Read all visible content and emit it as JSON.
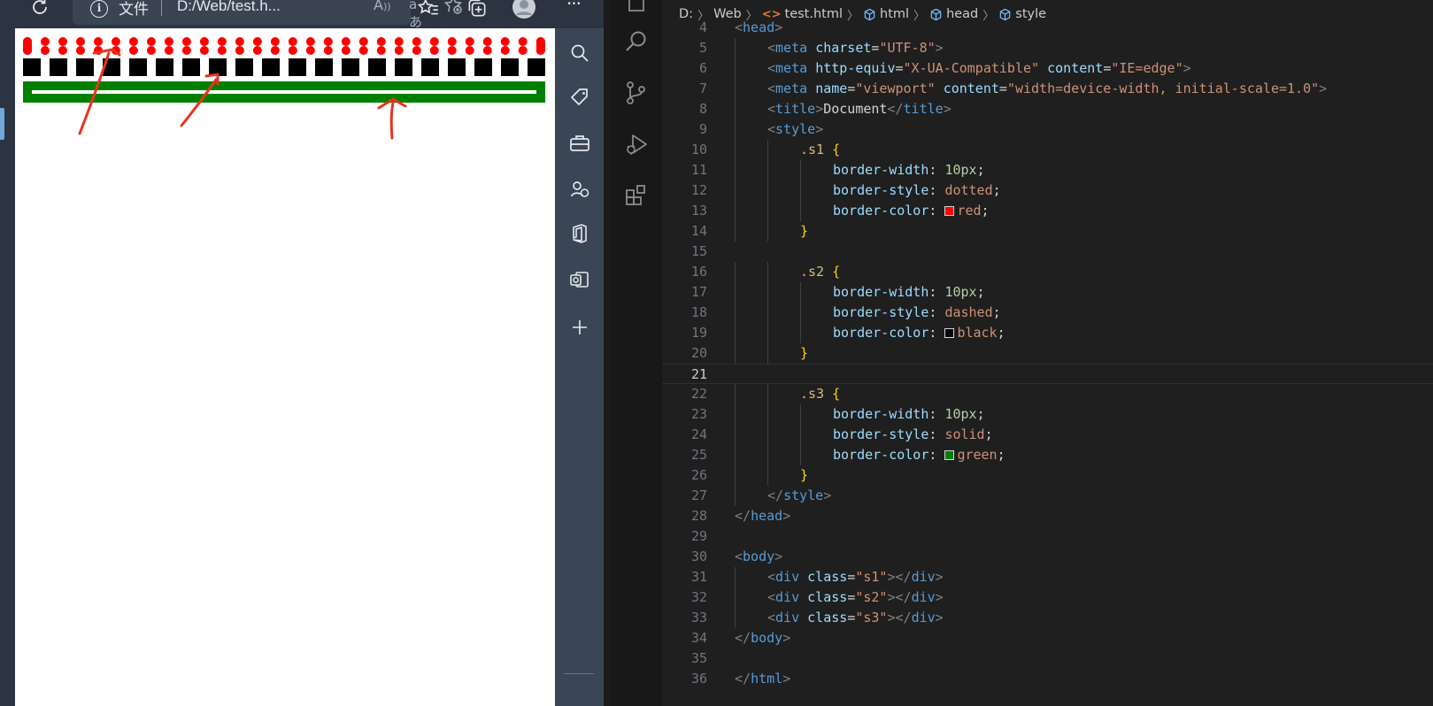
{
  "browser": {
    "address_label": "文件",
    "url": "D:/Web/test.h...",
    "translate_glyph": "aあ",
    "read_glyph": "A⁾"
  },
  "page": {
    "demo_colors": {
      "s1": "#ff0000",
      "s2": "#000000",
      "s3": "#008000"
    },
    "annotation_color": "#e8341c"
  },
  "editor": {
    "breadcrumbs": [
      "D:",
      "Web",
      "test.html",
      "html",
      "head",
      "style"
    ],
    "active_line": 21,
    "lines": [
      {
        "n": 4,
        "indent": 0,
        "tokens": [
          [
            "p",
            "<"
          ],
          [
            "t",
            "head"
          ],
          [
            "p",
            ">"
          ]
        ]
      },
      {
        "n": 5,
        "indent": 1,
        "tokens": [
          [
            "p",
            "<"
          ],
          [
            "t",
            "meta"
          ],
          [
            "x",
            " "
          ],
          [
            "a",
            "charset"
          ],
          [
            "x",
            "="
          ],
          [
            "s",
            "\"UTF-8\""
          ],
          [
            "p",
            ">"
          ]
        ]
      },
      {
        "n": 6,
        "indent": 1,
        "tokens": [
          [
            "p",
            "<"
          ],
          [
            "t",
            "meta"
          ],
          [
            "x",
            " "
          ],
          [
            "a",
            "http-equiv"
          ],
          [
            "x",
            "="
          ],
          [
            "s",
            "\"X-UA-Compatible\""
          ],
          [
            "x",
            " "
          ],
          [
            "a",
            "content"
          ],
          [
            "x",
            "="
          ],
          [
            "s",
            "\"IE=edge\""
          ],
          [
            "p",
            ">"
          ]
        ]
      },
      {
        "n": 7,
        "indent": 1,
        "tokens": [
          [
            "p",
            "<"
          ],
          [
            "t",
            "meta"
          ],
          [
            "x",
            " "
          ],
          [
            "a",
            "name"
          ],
          [
            "x",
            "="
          ],
          [
            "s",
            "\"viewport\""
          ],
          [
            "x",
            " "
          ],
          [
            "a",
            "content"
          ],
          [
            "x",
            "="
          ],
          [
            "s",
            "\"width=device-width, initial-scale=1.0\""
          ],
          [
            "p",
            ">"
          ]
        ]
      },
      {
        "n": 8,
        "indent": 1,
        "tokens": [
          [
            "p",
            "<"
          ],
          [
            "t",
            "title"
          ],
          [
            "p",
            ">"
          ],
          [
            "x",
            "Document"
          ],
          [
            "p",
            "</"
          ],
          [
            "t",
            "title"
          ],
          [
            "p",
            ">"
          ]
        ]
      },
      {
        "n": 9,
        "indent": 1,
        "tokens": [
          [
            "p",
            "<"
          ],
          [
            "t",
            "style"
          ],
          [
            "p",
            ">"
          ]
        ]
      },
      {
        "n": 10,
        "indent": 2,
        "tokens": [
          [
            "sel",
            ".s1"
          ],
          [
            "x",
            " "
          ],
          [
            "b",
            "{"
          ]
        ]
      },
      {
        "n": 11,
        "indent": 3,
        "tokens": [
          [
            "pr",
            "border-width"
          ],
          [
            "x",
            ": "
          ],
          [
            "num",
            "10px"
          ],
          [
            "x",
            ";"
          ]
        ]
      },
      {
        "n": 12,
        "indent": 3,
        "tokens": [
          [
            "pr",
            "border-style"
          ],
          [
            "x",
            ": "
          ],
          [
            "v",
            "dotted"
          ],
          [
            "x",
            ";"
          ]
        ]
      },
      {
        "n": 13,
        "indent": 3,
        "tokens": [
          [
            "pr",
            "border-color"
          ],
          [
            "x",
            ": "
          ],
          [
            "sw",
            "#ff0000"
          ],
          [
            "v",
            "red"
          ],
          [
            "x",
            ";"
          ]
        ]
      },
      {
        "n": 14,
        "indent": 2,
        "tokens": [
          [
            "b",
            "}"
          ]
        ]
      },
      {
        "n": 15,
        "indent": 0,
        "tokens": []
      },
      {
        "n": 16,
        "indent": 2,
        "tokens": [
          [
            "sel",
            ".s2"
          ],
          [
            "x",
            " "
          ],
          [
            "b",
            "{"
          ]
        ]
      },
      {
        "n": 17,
        "indent": 3,
        "tokens": [
          [
            "pr",
            "border-width"
          ],
          [
            "x",
            ": "
          ],
          [
            "num",
            "10px"
          ],
          [
            "x",
            ";"
          ]
        ]
      },
      {
        "n": 18,
        "indent": 3,
        "tokens": [
          [
            "pr",
            "border-style"
          ],
          [
            "x",
            ": "
          ],
          [
            "v",
            "dashed"
          ],
          [
            "x",
            ";"
          ]
        ]
      },
      {
        "n": 19,
        "indent": 3,
        "tokens": [
          [
            "pr",
            "border-color"
          ],
          [
            "x",
            ": "
          ],
          [
            "sw",
            "#000000"
          ],
          [
            "v",
            "black"
          ],
          [
            "x",
            ";"
          ]
        ]
      },
      {
        "n": 20,
        "indent": 2,
        "tokens": [
          [
            "b",
            "}"
          ]
        ]
      },
      {
        "n": 21,
        "indent": 0,
        "tokens": []
      },
      {
        "n": 22,
        "indent": 2,
        "tokens": [
          [
            "sel",
            ".s3"
          ],
          [
            "x",
            " "
          ],
          [
            "b",
            "{"
          ]
        ]
      },
      {
        "n": 23,
        "indent": 3,
        "tokens": [
          [
            "pr",
            "border-width"
          ],
          [
            "x",
            ": "
          ],
          [
            "num",
            "10px"
          ],
          [
            "x",
            ";"
          ]
        ]
      },
      {
        "n": 24,
        "indent": 3,
        "tokens": [
          [
            "pr",
            "border-style"
          ],
          [
            "x",
            ": "
          ],
          [
            "v",
            "solid"
          ],
          [
            "x",
            ";"
          ]
        ]
      },
      {
        "n": 25,
        "indent": 3,
        "tokens": [
          [
            "pr",
            "border-color"
          ],
          [
            "x",
            ": "
          ],
          [
            "sw",
            "#008000"
          ],
          [
            "v",
            "green"
          ],
          [
            "x",
            ";"
          ]
        ]
      },
      {
        "n": 26,
        "indent": 2,
        "tokens": [
          [
            "b",
            "}"
          ]
        ]
      },
      {
        "n": 27,
        "indent": 1,
        "tokens": [
          [
            "p",
            "</"
          ],
          [
            "t",
            "style"
          ],
          [
            "p",
            ">"
          ]
        ]
      },
      {
        "n": 28,
        "indent": 0,
        "tokens": [
          [
            "p",
            "</"
          ],
          [
            "t",
            "head"
          ],
          [
            "p",
            ">"
          ]
        ]
      },
      {
        "n": 29,
        "indent": 0,
        "tokens": []
      },
      {
        "n": 30,
        "indent": 0,
        "tokens": [
          [
            "p",
            "<"
          ],
          [
            "t",
            "body"
          ],
          [
            "p",
            ">"
          ]
        ]
      },
      {
        "n": 31,
        "indent": 1,
        "tokens": [
          [
            "p",
            "<"
          ],
          [
            "t",
            "div"
          ],
          [
            "x",
            " "
          ],
          [
            "a",
            "class"
          ],
          [
            "x",
            "="
          ],
          [
            "s",
            "\"s1\""
          ],
          [
            "p",
            "></"
          ],
          [
            "t",
            "div"
          ],
          [
            "p",
            ">"
          ]
        ]
      },
      {
        "n": 32,
        "indent": 1,
        "tokens": [
          [
            "p",
            "<"
          ],
          [
            "t",
            "div"
          ],
          [
            "x",
            " "
          ],
          [
            "a",
            "class"
          ],
          [
            "x",
            "="
          ],
          [
            "s",
            "\"s2\""
          ],
          [
            "p",
            "></"
          ],
          [
            "t",
            "div"
          ],
          [
            "p",
            ">"
          ]
        ]
      },
      {
        "n": 33,
        "indent": 1,
        "tokens": [
          [
            "p",
            "<"
          ],
          [
            "t",
            "div"
          ],
          [
            "x",
            " "
          ],
          [
            "a",
            "class"
          ],
          [
            "x",
            "="
          ],
          [
            "s",
            "\"s3\""
          ],
          [
            "p",
            "></"
          ],
          [
            "t",
            "div"
          ],
          [
            "p",
            ">"
          ]
        ]
      },
      {
        "n": 34,
        "indent": 0,
        "tokens": [
          [
            "p",
            "</"
          ],
          [
            "t",
            "body"
          ],
          [
            "p",
            ">"
          ]
        ]
      },
      {
        "n": 35,
        "indent": 0,
        "tokens": []
      },
      {
        "n": 36,
        "indent": 0,
        "tokens": [
          [
            "p",
            "</"
          ],
          [
            "t",
            "html"
          ],
          [
            "p",
            ">"
          ]
        ]
      }
    ]
  }
}
